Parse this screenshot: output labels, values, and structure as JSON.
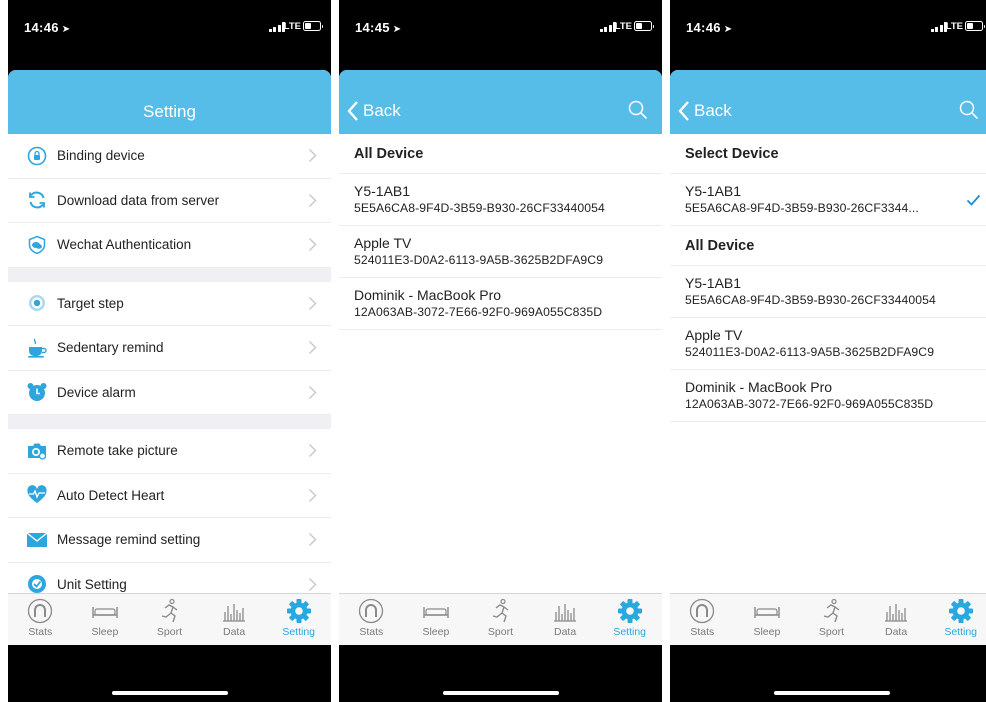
{
  "screens": [
    {
      "status": {
        "time": "14:46",
        "carrier": "LTE"
      },
      "title": "Setting",
      "groups": [
        [
          {
            "label": "Binding device",
            "icon": "binding-icon"
          },
          {
            "label": "Download data from server",
            "icon": "sync-icon"
          },
          {
            "label": "Wechat Authentication",
            "icon": "wechat-icon"
          }
        ],
        [
          {
            "label": "Target step",
            "icon": "target-icon"
          },
          {
            "label": "Sedentary remind",
            "icon": "coffee-cup-icon"
          },
          {
            "label": "Device alarm",
            "icon": "alarm-clock-icon"
          }
        ],
        [
          {
            "label": "Remote take picture",
            "icon": "camera-icon"
          },
          {
            "label": "Auto Detect Heart",
            "icon": "heart-icon"
          },
          {
            "label": "Message remind setting",
            "icon": "envelope-icon"
          },
          {
            "label": "Unit Setting",
            "icon": "unit-icon"
          }
        ]
      ]
    },
    {
      "status": {
        "time": "14:45",
        "carrier": "LTE"
      },
      "back": "Back",
      "all_header": "All Device",
      "devices": [
        {
          "name": "Y5-1AB1",
          "id": "5E5A6CA8-9F4D-3B59-B930-26CF33440054"
        },
        {
          "name": "Apple TV",
          "id": "524011E3-D0A2-6113-9A5B-3625B2DFA9C9"
        },
        {
          "name": "Dominik - MacBook Pro",
          "id": "12A063AB-3072-7E66-92F0-969A055C835D"
        }
      ]
    },
    {
      "status": {
        "time": "14:46",
        "carrier": "LTE"
      },
      "back": "Back",
      "select_header": "Select Device",
      "selected": {
        "name": "Y5-1AB1",
        "id": "5E5A6CA8-9F4D-3B59-B930-26CF3344..."
      },
      "all_header": "All Device",
      "devices": [
        {
          "name": "Y5-1AB1",
          "id": "5E5A6CA8-9F4D-3B59-B930-26CF33440054"
        },
        {
          "name": "Apple TV",
          "id": "524011E3-D0A2-6113-9A5B-3625B2DFA9C9"
        },
        {
          "name": "Dominik - MacBook Pro",
          "id": "12A063AB-3072-7E66-92F0-969A055C835D"
        }
      ]
    }
  ],
  "tabs": [
    {
      "label": "Stats",
      "icon": "stats-icon"
    },
    {
      "label": "Sleep",
      "icon": "bed-icon"
    },
    {
      "label": "Sport",
      "icon": "running-person-icon"
    },
    {
      "label": "Data",
      "icon": "bar-chart-icon"
    },
    {
      "label": "Setting",
      "icon": "gear-icon",
      "active": true
    }
  ],
  "colors": {
    "accent": "#56bde9",
    "active_tab": "#29a8e0",
    "checkmark": "#1f8ad4"
  }
}
